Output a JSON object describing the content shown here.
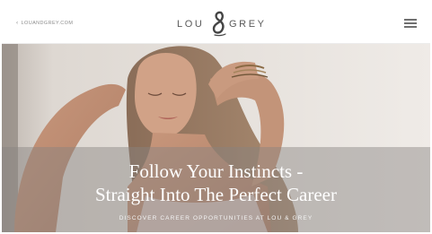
{
  "header": {
    "back_link": "LOUANDGREY.COM",
    "logo_left": "LOU",
    "logo_right": "GREY"
  },
  "hero": {
    "title_line1": "Follow Your Instincts -",
    "title_line2": "Straight Into The Perfect Career",
    "cta": "DISCOVER CAREER OPPORTUNITIES AT LOU & GREY"
  },
  "icons": {
    "back": "chevron-left-icon",
    "logo_mark": "ampersand-logo",
    "menu": "hamburger-menu-icon"
  },
  "colors": {
    "header_bg": "#ffffff",
    "logo_text": "#5a5a5a",
    "hero_text": "#ffffff",
    "overlay": "#878280"
  }
}
